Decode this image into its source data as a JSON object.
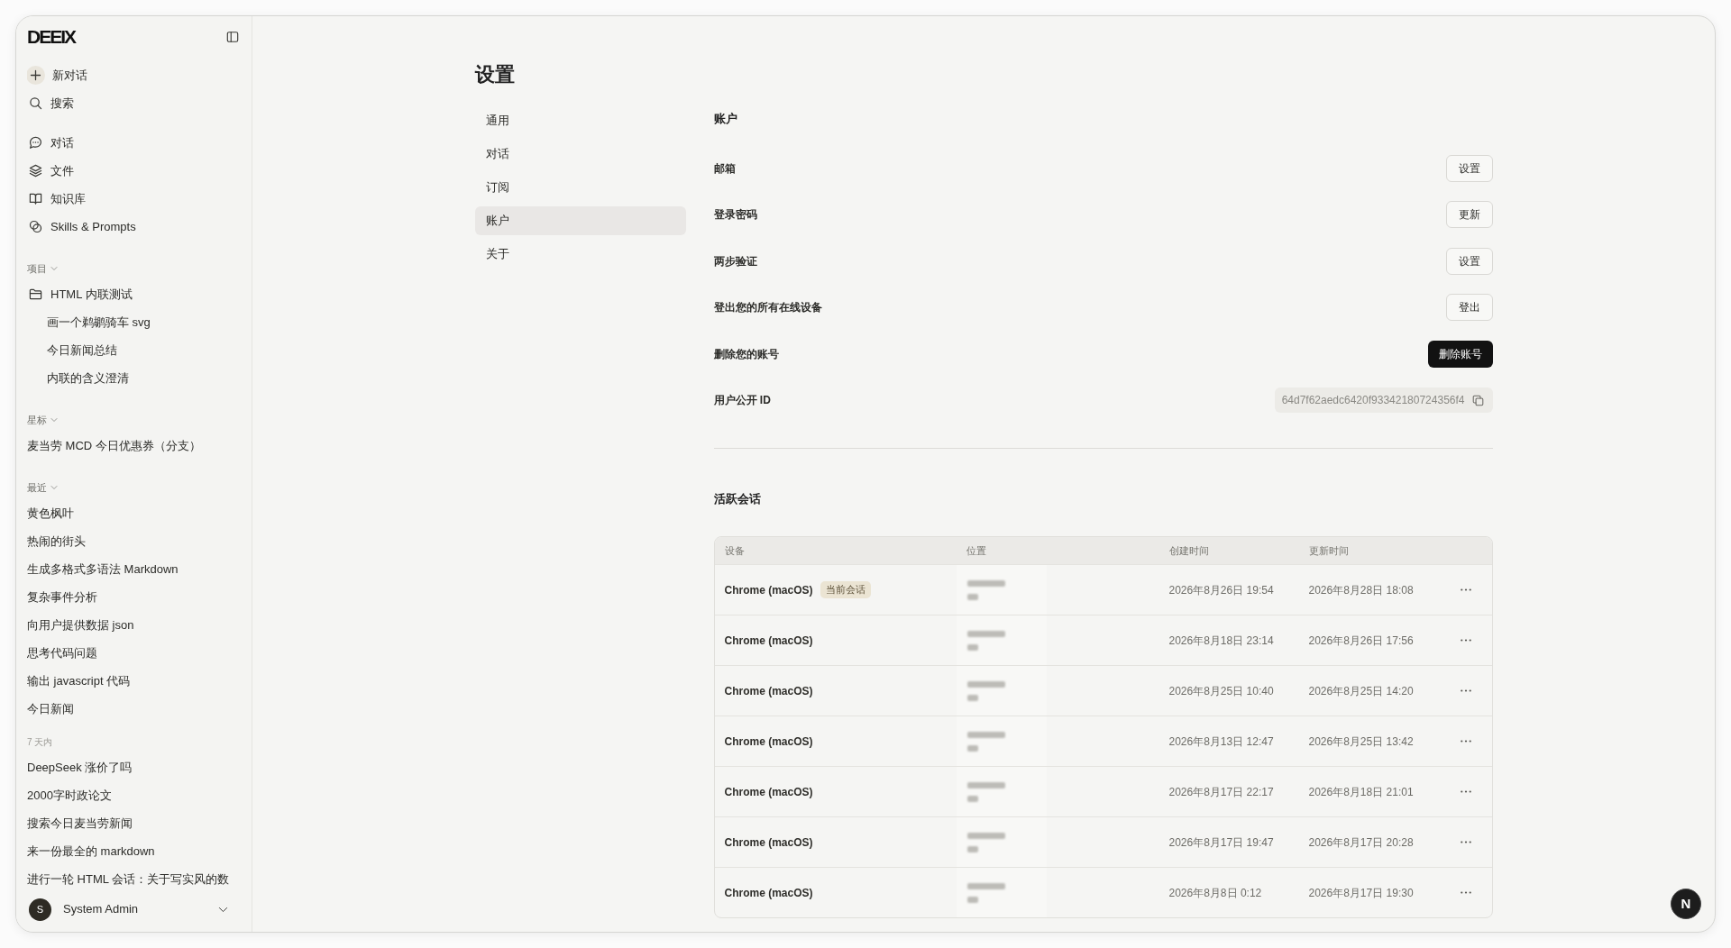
{
  "sidebar": {
    "logo": "DEEIX",
    "actions": [
      {
        "label": "新对话"
      },
      {
        "label": "搜索"
      }
    ],
    "nav": [
      {
        "label": "对话"
      },
      {
        "label": "文件"
      },
      {
        "label": "知识库"
      },
      {
        "label": "Skills & Prompts"
      }
    ],
    "projects": {
      "title": "项目",
      "expanded": true,
      "items": [
        {
          "label": "HTML 内联测试",
          "children": [
            {
              "label": "画一个鹈鹕骑车 svg"
            },
            {
              "label": "今日新闻总结"
            },
            {
              "label": "内联的含义澄清"
            }
          ]
        }
      ]
    },
    "starred": {
      "title": "星标",
      "expanded": true,
      "items": [
        {
          "label": "麦当劳 MCD 今日优惠券（分支）"
        }
      ]
    },
    "recent": {
      "title": "最近",
      "expanded": true,
      "items": [
        {
          "label": "黄色枫叶"
        },
        {
          "label": "热闹的街头"
        },
        {
          "label": "生成多格式多语法 Markdown"
        },
        {
          "label": "复杂事件分析"
        },
        {
          "label": "向用户提供数据 json"
        },
        {
          "label": "思考代码问题"
        },
        {
          "label": "输出 javascript 代码"
        },
        {
          "label": "今日新闻"
        }
      ],
      "groups": [
        {
          "title": "7 天内",
          "items": [
            {
              "label": "DeepSeek 涨价了吗"
            },
            {
              "label": "2000字时政论文"
            },
            {
              "label": "搜索今日麦当劳新闻"
            },
            {
              "label": "来一份最全的 markdown"
            },
            {
              "label": "进行一轮 HTML 会话：关于写实风的数"
            }
          ]
        }
      ]
    },
    "user": {
      "initial": "S",
      "name": "System Admin"
    }
  },
  "settings": {
    "title": "设置",
    "tabs": [
      {
        "label": "通用",
        "selected": false
      },
      {
        "label": "对话",
        "selected": false
      },
      {
        "label": "订阅",
        "selected": false
      },
      {
        "label": "账户",
        "selected": true
      },
      {
        "label": "关于",
        "selected": false
      }
    ],
    "account": {
      "title": "账户",
      "rows": [
        {
          "label": "邮箱",
          "kind": "button",
          "button": "设置"
        },
        {
          "label": "登录密码",
          "kind": "button",
          "button": "更新"
        },
        {
          "label": "两步验证",
          "kind": "button",
          "button": "设置"
        },
        {
          "label": "登出您的所有在线设备",
          "kind": "button",
          "button": "登出"
        },
        {
          "label": "删除您的账号",
          "kind": "danger",
          "button": "删除账号"
        },
        {
          "label": "用户公开 ID",
          "kind": "id",
          "value": "64d7f62aedc6420f93342180724356f4"
        }
      ]
    },
    "sessions": {
      "title": "活跃会话",
      "columns": [
        "设备",
        "位置",
        "创建时间",
        "更新时间"
      ],
      "rows": [
        {
          "device": "Chrome (macOS)",
          "badge": "当前会话",
          "created": "2026年8月26日 19:54",
          "updated": "2026年8月28日 18:08"
        },
        {
          "device": "Chrome (macOS)",
          "created": "2026年8月18日 23:14",
          "updated": "2026年8月26日 17:56"
        },
        {
          "device": "Chrome (macOS)",
          "created": "2026年8月25日 10:40",
          "updated": "2026年8月25日 14:20"
        },
        {
          "device": "Chrome (macOS)",
          "created": "2026年8月13日 12:47",
          "updated": "2026年8月25日 13:42"
        },
        {
          "device": "Chrome (macOS)",
          "created": "2026年8月17日 22:17",
          "updated": "2026年8月18日 21:01"
        },
        {
          "device": "Chrome (macOS)",
          "created": "2026年8月17日 19:47",
          "updated": "2026年8月17日 20:28"
        },
        {
          "device": "Chrome (macOS)",
          "created": "2026年8月8日 0:12",
          "updated": "2026年8月17日 19:30"
        }
      ]
    }
  },
  "dev_indicator": {
    "label": "N"
  }
}
